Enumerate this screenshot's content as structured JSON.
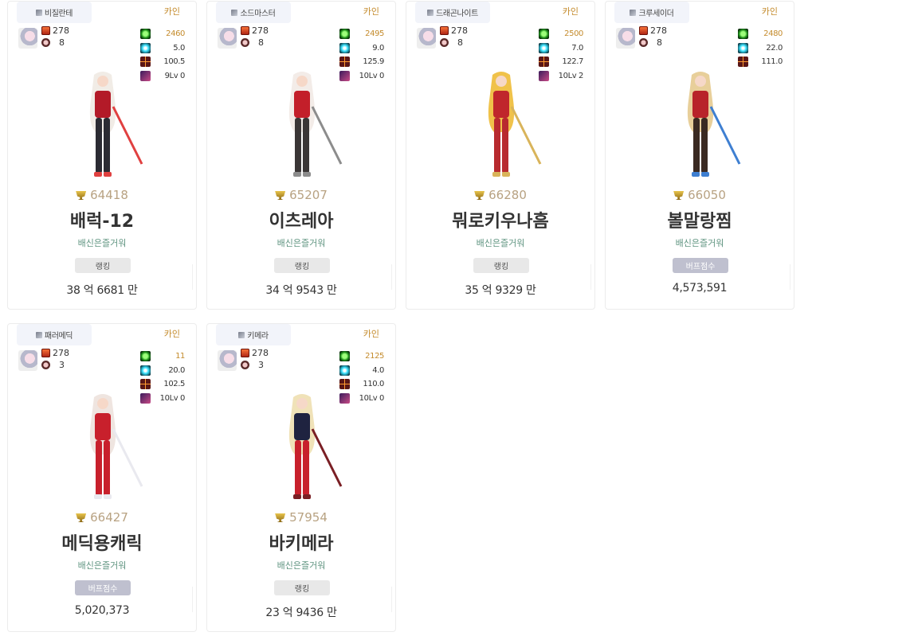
{
  "cards": [
    {
      "job": "비질란테",
      "server": "카인",
      "level": "278",
      "hexa": "8",
      "stats": [
        "2460",
        "5.0",
        "100.5",
        "9Lv 0"
      ],
      "fame": "64418",
      "name": "배럭-12",
      "adventure": "배신은즐거워",
      "tag": "랭킹",
      "tag_type": "ranking",
      "score": "38 억 6681 만",
      "colors": {
        "hair": "#f1ece6",
        "top": "#b31a28",
        "leg": "#2b2b33",
        "accent": "#e04040"
      }
    },
    {
      "job": "소드마스터",
      "server": "카인",
      "level": "278",
      "hexa": "8",
      "stats": [
        "2495",
        "9.0",
        "125.9",
        "10Lv 0"
      ],
      "fame": "65207",
      "name": "이츠레아",
      "adventure": "배신은즐거워",
      "tag": "랭킹",
      "tag_type": "ranking",
      "score": "34 억 9543 만",
      "colors": {
        "hair": "#f3ece8",
        "top": "#c31f2a",
        "leg": "#3a3636",
        "accent": "#8c8c8c"
      }
    },
    {
      "job": "드래곤나이트",
      "server": "카인",
      "level": "278",
      "hexa": "8",
      "stats": [
        "2500",
        "7.0",
        "122.7",
        "10Lv 2"
      ],
      "fame": "66280",
      "name": "뭐로키우나흠",
      "adventure": "배신은즐거워",
      "tag": "랭킹",
      "tag_type": "ranking",
      "score": "35 억 9329 만",
      "colors": {
        "hair": "#f0c24a",
        "top": "#c0262c",
        "leg": "#b82a2f",
        "accent": "#d9b45a"
      }
    },
    {
      "job": "크루세이더",
      "server": "카인",
      "level": "278",
      "hexa": "8",
      "stats": [
        "2480",
        "22.0",
        "111.0"
      ],
      "fame": "66050",
      "name": "볼말랑찜",
      "adventure": "배신은즐거워",
      "tag": "버프점수",
      "tag_type": "buff",
      "score": "4,573,591",
      "colors": {
        "hair": "#e8cf9a",
        "top": "#b8232a",
        "leg": "#3a2a22",
        "accent": "#3e7fd1"
      }
    },
    {
      "job": "패러메딕",
      "server": "카인",
      "level": "278",
      "hexa": "3",
      "stats": [
        "11",
        "20.0",
        "102.5",
        "10Lv 0"
      ],
      "fame": "66427",
      "name": "메딕용캐릭",
      "adventure": "배신은즐거워",
      "tag": "버프점수",
      "tag_type": "buff",
      "score": "5,020,373",
      "colors": {
        "hair": "#efe5e0",
        "top": "#c8202c",
        "leg": "#c8202c",
        "accent": "#e9e9ef"
      }
    },
    {
      "job": "키메라",
      "server": "카인",
      "level": "278",
      "hexa": "3",
      "stats": [
        "2125",
        "4.0",
        "110.0",
        "10Lv 0"
      ],
      "fame": "57954",
      "name": "바키메라",
      "adventure": "배신은즐거워",
      "tag": "랭킹",
      "tag_type": "ranking",
      "score": "23 억 9436 만",
      "colors": {
        "hair": "#f0e2b8",
        "top": "#1f2340",
        "leg": "#c8202c",
        "accent": "#7a1f24"
      }
    }
  ]
}
